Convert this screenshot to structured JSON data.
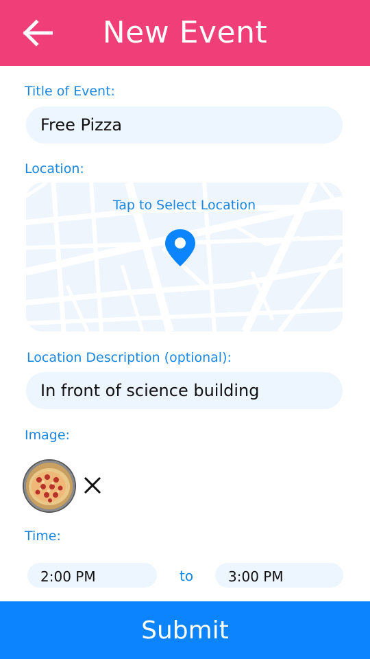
{
  "header": {
    "title": "New Event",
    "back_icon": "arrow-left-icon",
    "color": "#ef3e78"
  },
  "form": {
    "title_label": "Title of Event:",
    "title_value": "Free Pizza",
    "location_label": "Location:",
    "map_prompt": "Tap to Select Location",
    "map_pin_icon": "map-pin-icon",
    "location_desc_label": "Location Description (optional):",
    "location_desc_value": "In front of science building",
    "image_label": "Image:",
    "remove_image_icon": "close-icon",
    "time_label": "Time:",
    "start_time": "2:00 PM",
    "time_separator": "to",
    "end_time": "3:00 PM"
  },
  "submit": {
    "label": "Submit",
    "color": "#0b84fe"
  },
  "colors": {
    "label_text": "#1a86e0",
    "field_background": "#edf5fe"
  }
}
